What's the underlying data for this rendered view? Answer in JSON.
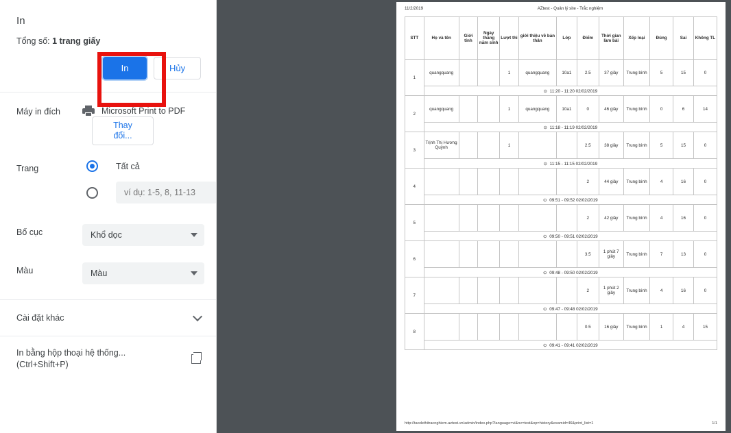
{
  "dialog": {
    "title": "In",
    "total_label": "Tổng số:",
    "total_value": "1 trang giấy",
    "print_button": "In",
    "cancel_button": "Hủy",
    "destination_label": "Máy in đích",
    "destination_value": "Microsoft Print to PDF",
    "change_button_line1": "Thay",
    "change_button_line2": "đổi...",
    "pages_label": "Trang",
    "pages_all_option": "Tất cả",
    "pages_custom_placeholder": "ví dụ: 1-5, 8, 11-13",
    "pages_custom_value": "",
    "layout_label": "Bố cục",
    "layout_value": "Khổ dọc",
    "color_label": "Màu",
    "color_value": "Màu",
    "more_settings_label": "Cài đặt khác",
    "system_dialog_line1": "In bằng hộp thoại hệ thống...",
    "system_dialog_line2": "(Ctrl+Shift+P)",
    "accent_color": "#1a73e8",
    "highlight_color": "#e8120e"
  },
  "preview": {
    "header_date": "11/2/2019",
    "header_title": "AZtest - Quản lý site - Trắc nghiệm",
    "footer_url": "http://taodethitracnghiem.aztest.vn/admin/index.php?language=vi&nv=test&op=history&examid=46&print_list=1",
    "footer_page": "1/1",
    "columns": [
      "STT",
      "Họ và tên",
      "Giới tính",
      "Ngày tháng năm sinh",
      "Lượt thi",
      "giới thiệu về bản thân",
      "Lớp",
      "Điểm",
      "Thời gian làm bài",
      "Xếp loại",
      "Đúng",
      "Sai",
      "Không TL"
    ],
    "rows": [
      {
        "stt": "1",
        "name": "quangquang",
        "gender": "",
        "birth": "",
        "attempts": "1",
        "intro": "quangquang",
        "class": "10a1",
        "score": "2.5",
        "duration": "37 giây",
        "rank": "Trung bình",
        "correct": "5",
        "wrong": "15",
        "blank": "0",
        "timestamp": "11:20 - 11:20 02/02/2019"
      },
      {
        "stt": "2",
        "name": "quangquang",
        "gender": "",
        "birth": "",
        "attempts": "1",
        "intro": "quangquang",
        "class": "10a1",
        "score": "0",
        "duration": "46 giây",
        "rank": "Trung bình",
        "correct": "0",
        "wrong": "6",
        "blank": "14",
        "timestamp": "11:18 - 11:19 02/02/2019"
      },
      {
        "stt": "3",
        "name": "Trịnh Thị Hương Quỳnh",
        "gender": "",
        "birth": "",
        "attempts": "1",
        "intro": "",
        "class": "",
        "score": "2.5",
        "duration": "38 giây",
        "rank": "Trung bình",
        "correct": "5",
        "wrong": "15",
        "blank": "0",
        "timestamp": "11:15 - 11:15 02/02/2019"
      },
      {
        "stt": "4",
        "name": "",
        "gender": "",
        "birth": "",
        "attempts": "",
        "intro": "",
        "class": "",
        "score": "2",
        "duration": "44 giây",
        "rank": "Trung bình",
        "correct": "4",
        "wrong": "16",
        "blank": "0",
        "timestamp": "09:51 - 09:52 02/02/2019"
      },
      {
        "stt": "5",
        "name": "",
        "gender": "",
        "birth": "",
        "attempts": "",
        "intro": "",
        "class": "",
        "score": "2",
        "duration": "42 giây",
        "rank": "Trung bình",
        "correct": "4",
        "wrong": "16",
        "blank": "0",
        "timestamp": "09:50 - 09:51 02/02/2019"
      },
      {
        "stt": "6",
        "name": "",
        "gender": "",
        "birth": "",
        "attempts": "",
        "intro": "",
        "class": "",
        "score": "3.5",
        "duration": "1 phút 7 giây",
        "rank": "Trung bình",
        "correct": "7",
        "wrong": "13",
        "blank": "0",
        "timestamp": "09:48 - 09:50 02/02/2019"
      },
      {
        "stt": "7",
        "name": "",
        "gender": "",
        "birth": "",
        "attempts": "",
        "intro": "",
        "class": "",
        "score": "2",
        "duration": "1 phút 2 giây",
        "rank": "Trung bình",
        "correct": "4",
        "wrong": "16",
        "blank": "0",
        "timestamp": "09:47 - 09:48 02/02/2019"
      },
      {
        "stt": "8",
        "name": "",
        "gender": "",
        "birth": "",
        "attempts": "",
        "intro": "",
        "class": "",
        "score": "0.5",
        "duration": "16 giây",
        "rank": "Trung bình",
        "correct": "1",
        "wrong": "4",
        "blank": "15",
        "timestamp": "09:41 - 09:41 02/02/2019"
      }
    ],
    "clock_icon": "⊙"
  }
}
